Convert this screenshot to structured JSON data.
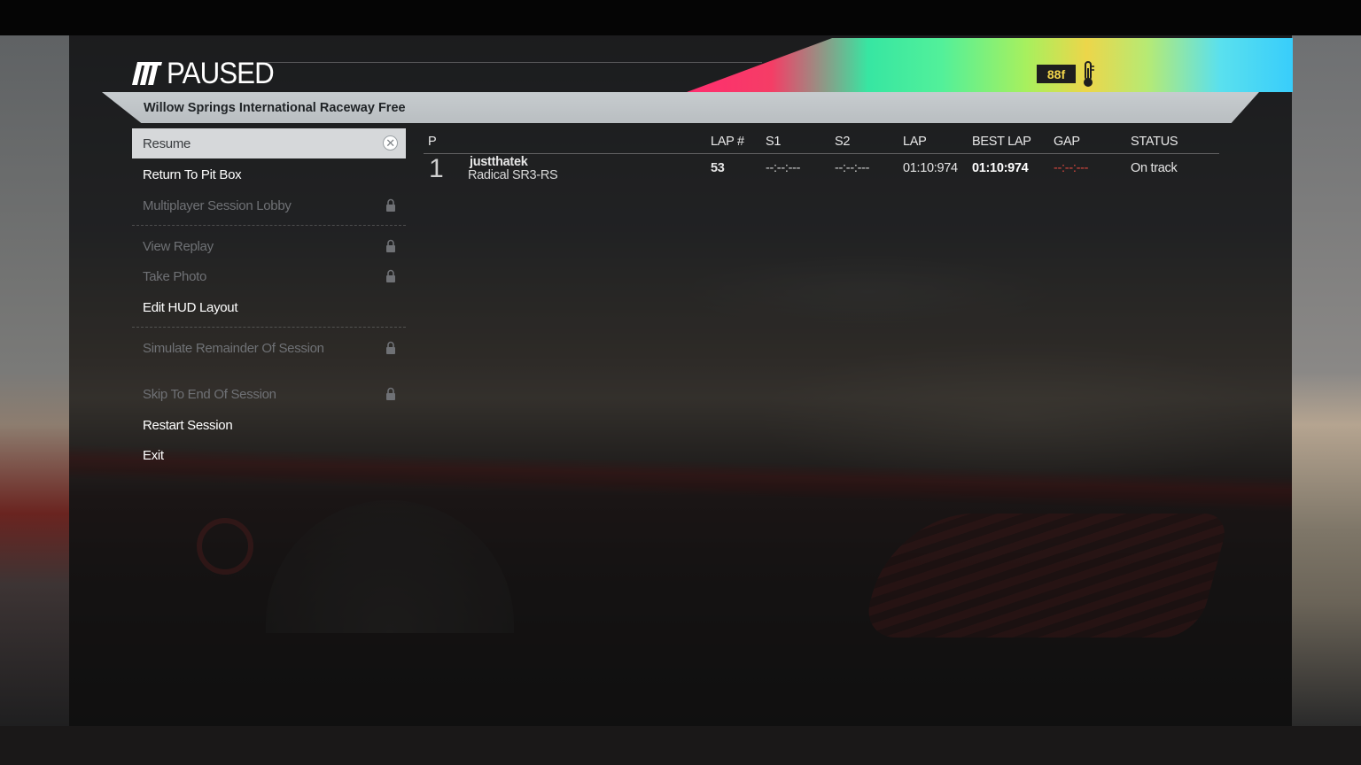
{
  "header": {
    "title": "PAUSED",
    "temperature": "88f",
    "temperature_icon": "thermometer-icon",
    "track_name": "Willow Springs International Raceway Free"
  },
  "menu": {
    "items": [
      {
        "label": "Resume",
        "state": "selected"
      },
      {
        "label": "Return To Pit Box",
        "state": "enabled"
      },
      {
        "label": "Multiplayer Session Lobby",
        "state": "locked"
      },
      {
        "label": "View Replay",
        "state": "locked"
      },
      {
        "label": "Take Photo",
        "state": "locked"
      },
      {
        "label": "Edit HUD Layout",
        "state": "enabled"
      },
      {
        "label": "Simulate Remainder Of Session",
        "state": "locked"
      },
      {
        "label": "Skip To End Of Session",
        "state": "locked"
      },
      {
        "label": "Restart Session",
        "state": "enabled"
      },
      {
        "label": "Exit",
        "state": "enabled"
      }
    ]
  },
  "results": {
    "columns": [
      "P",
      "LAP #",
      "S1",
      "S2",
      "LAP",
      "BEST LAP",
      "GAP",
      "STATUS"
    ],
    "rows": [
      {
        "position": "1",
        "driver": "justthatek",
        "car": "Radical SR3-RS",
        "lap_number": "53",
        "s1": "--:--:---",
        "s2": "--:--:---",
        "lap": "01:10:974",
        "best_lap": "01:10:974",
        "gap": "--:--:---",
        "status": "On track"
      }
    ]
  },
  "colors": {
    "gap_color": "#d8473f",
    "temp_badge_text": "#f2d54b",
    "selected_bg": "#d6d8da"
  }
}
